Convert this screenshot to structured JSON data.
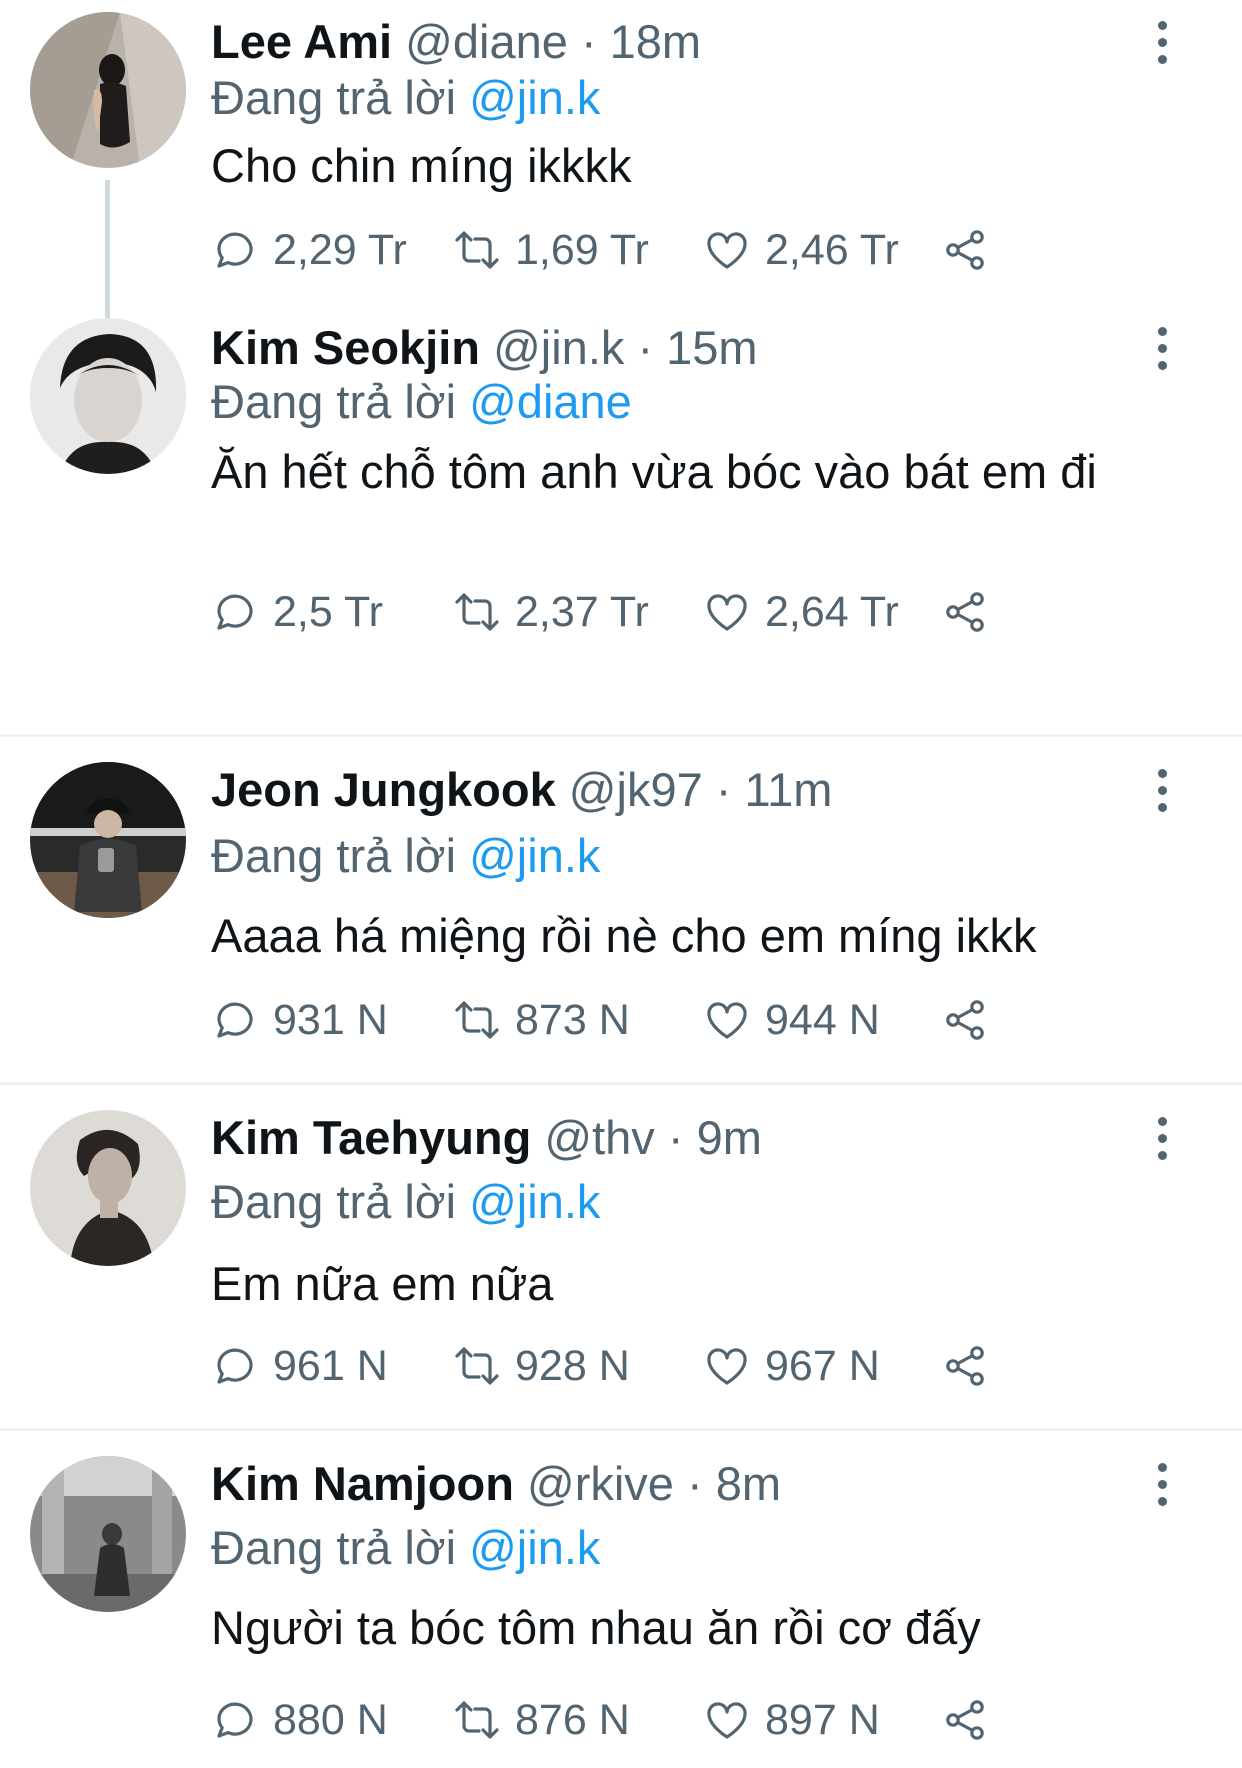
{
  "tweets": [
    {
      "name": "Lee Ami",
      "handle": "@diane",
      "sep": "·",
      "time": "18m",
      "reply_prefix": "Đang trả lời",
      "reply_to": "@jin.k",
      "text": "Cho chin míng ikkkk",
      "replies": "2,29 Tr",
      "retweets": "1,69 Tr",
      "likes": "2,46 Tr"
    },
    {
      "name": "Kim Seokjin",
      "handle": "@jin.k",
      "sep": "·",
      "time": "15m",
      "reply_prefix": "Đang trả lời",
      "reply_to": "@diane",
      "text": "Ăn hết chỗ tôm anh vừa bóc vào bát em đi",
      "replies": "2,5 Tr",
      "retweets": "2,37 Tr",
      "likes": "2,64 Tr"
    },
    {
      "name": "Jeon Jungkook",
      "handle": "@jk97",
      "sep": "·",
      "time": "11m",
      "reply_prefix": "Đang trả lời",
      "reply_to": "@jin.k",
      "text": "Aaaa há miệng rồi nè cho em míng ikkk",
      "replies": "931 N",
      "retweets": "873 N",
      "likes": "944 N"
    },
    {
      "name": "Kim Taehyung",
      "handle": "@thv",
      "sep": "·",
      "time": "9m",
      "reply_prefix": "Đang trả lời",
      "reply_to": "@jin.k",
      "text": "Em nữa em nữa",
      "replies": "961 N",
      "retweets": "928 N",
      "likes": "967 N"
    },
    {
      "name": "Kim Namjoon",
      "handle": "@rkive",
      "sep": "·",
      "time": "8m",
      "reply_prefix": "Đang trả lời",
      "reply_to": "@jin.k",
      "text": "Người ta bóc tôm nhau ăn rồi cơ đấy",
      "replies": "880 N",
      "retweets": "876 N",
      "likes": "897 N"
    }
  ],
  "icons": {
    "reply": "reply-icon",
    "retweet": "retweet-icon",
    "like": "heart-icon",
    "share": "share-icon",
    "more": "more-vertical-icon"
  },
  "colors": {
    "text": "#0f1419",
    "muted": "#536471",
    "mention": "#1d9bf0",
    "divider": "#eff3f4"
  }
}
